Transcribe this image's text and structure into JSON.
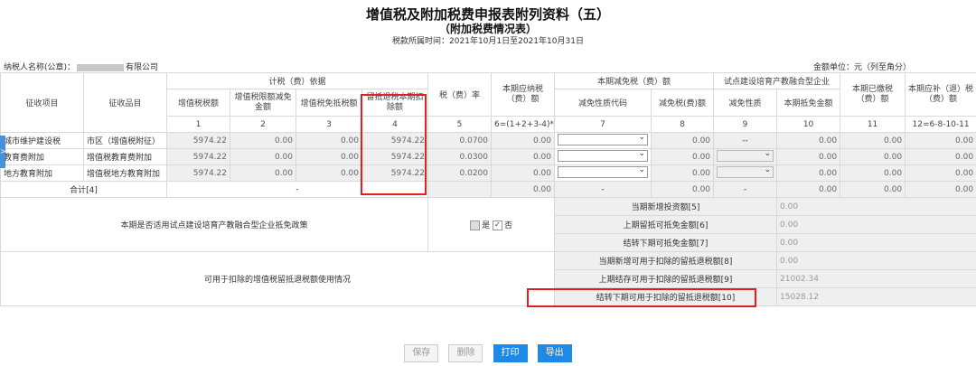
{
  "header": {
    "title": "增值税及附加税费申报表附列资料（五）",
    "subtitle": "（附加税费情况表）",
    "period": "税款所属时间：2021年10月1日至2021年10月31日",
    "taxpayer_label": "纳税人名称(公章)：",
    "taxpayer_suffix": "有限公司",
    "unit": "金额单位：元（列至角分）"
  },
  "columns": {
    "tax_item": "征收项目",
    "tax_subitem": "征收品目",
    "basis_group": "计税（费）依据",
    "vat_amount": "增值税税额",
    "vat_reduction": "增值税限额减免金额",
    "vat_exempt_offset": "增值税免抵税额",
    "refund_deduction": "留抵退税本期扣除额",
    "rate": "税（费）率",
    "payable": "本期应纳税（费）额",
    "relief_group": "本期减免税（费）额",
    "relief_code": "减免性质代码",
    "relief_amount": "减免税(费)额",
    "pilot_group": "试点建设培育产教融合型企业",
    "pilot_code": "减免性质",
    "pilot_amount": "本期抵免金额",
    "paid": "本期已缴税（费）额",
    "supplement": "本期应补（退）税（费）额"
  },
  "column_numbers": [
    "1",
    "2",
    "3",
    "4",
    "5",
    "6=(1+2+3-4)*5",
    "7",
    "8",
    "9",
    "10",
    "11",
    "12=6-8-10-11"
  ],
  "rows": [
    {
      "item": "城市维护建设税",
      "subitem": "市区（增值税附征）",
      "c1": "5974.22",
      "c2": "0.00",
      "c3": "0.00",
      "c4": "5974.22",
      "c5": "0.0700",
      "c6": "0.00",
      "c8": "0.00",
      "c9": "--",
      "c10": "0.00",
      "c11": "0.00",
      "c12": "0.00"
    },
    {
      "item": "教育费附加",
      "subitem": "增值税教育费附加",
      "c1": "5974.22",
      "c2": "0.00",
      "c3": "0.00",
      "c4": "5974.22",
      "c5": "0.0300",
      "c6": "0.00",
      "c8": "0.00",
      "c10": "0.00",
      "c11": "0.00",
      "c12": "0.00"
    },
    {
      "item": "地方教育附加",
      "subitem": "增值税地方教育附加",
      "c1": "5974.22",
      "c2": "0.00",
      "c3": "0.00",
      "c4": "5974.22",
      "c5": "0.0200",
      "c6": "0.00",
      "c8": "0.00",
      "c10": "0.00",
      "c11": "0.00",
      "c12": "0.00"
    }
  ],
  "total": {
    "label": "合计[4]",
    "c3": "-",
    "c6": "0.00",
    "c7": "-",
    "c8": "0.00",
    "c9": "-",
    "c10": "0.00",
    "c11": "0.00",
    "c12": "0.00"
  },
  "pilot_policy": {
    "question": "本期是否适用试点建设培育产教融合型企业抵免政策",
    "yes_label": "是",
    "no_label": "否",
    "yes_checked": false,
    "no_checked": true,
    "items": [
      {
        "label": "当期新增投资额[5]",
        "value": "0.00"
      },
      {
        "label": "上期留抵可抵免金额[6]",
        "value": "0.00"
      },
      {
        "label": "结转下期可抵免金额[7]",
        "value": "0.00"
      }
    ]
  },
  "refund_usage": {
    "title": "可用于扣除的增值税留抵退税额使用情况",
    "items": [
      {
        "label": "当期新增可用于扣除的留抵退税额[8]",
        "value": "0.00"
      },
      {
        "label": "上期结存可用于扣除的留抵退税额[9]",
        "value": "21002.34"
      },
      {
        "label": "结转下期可用于扣除的留抵退税额[10]",
        "value": "15028.12"
      }
    ]
  },
  "buttons": {
    "save": "保存",
    "delete": "删除",
    "print": "打印",
    "export": "导出"
  },
  "side_tab": ">",
  "colors": {
    "highlight": "#e02020",
    "primary": "#1f8ae6"
  }
}
